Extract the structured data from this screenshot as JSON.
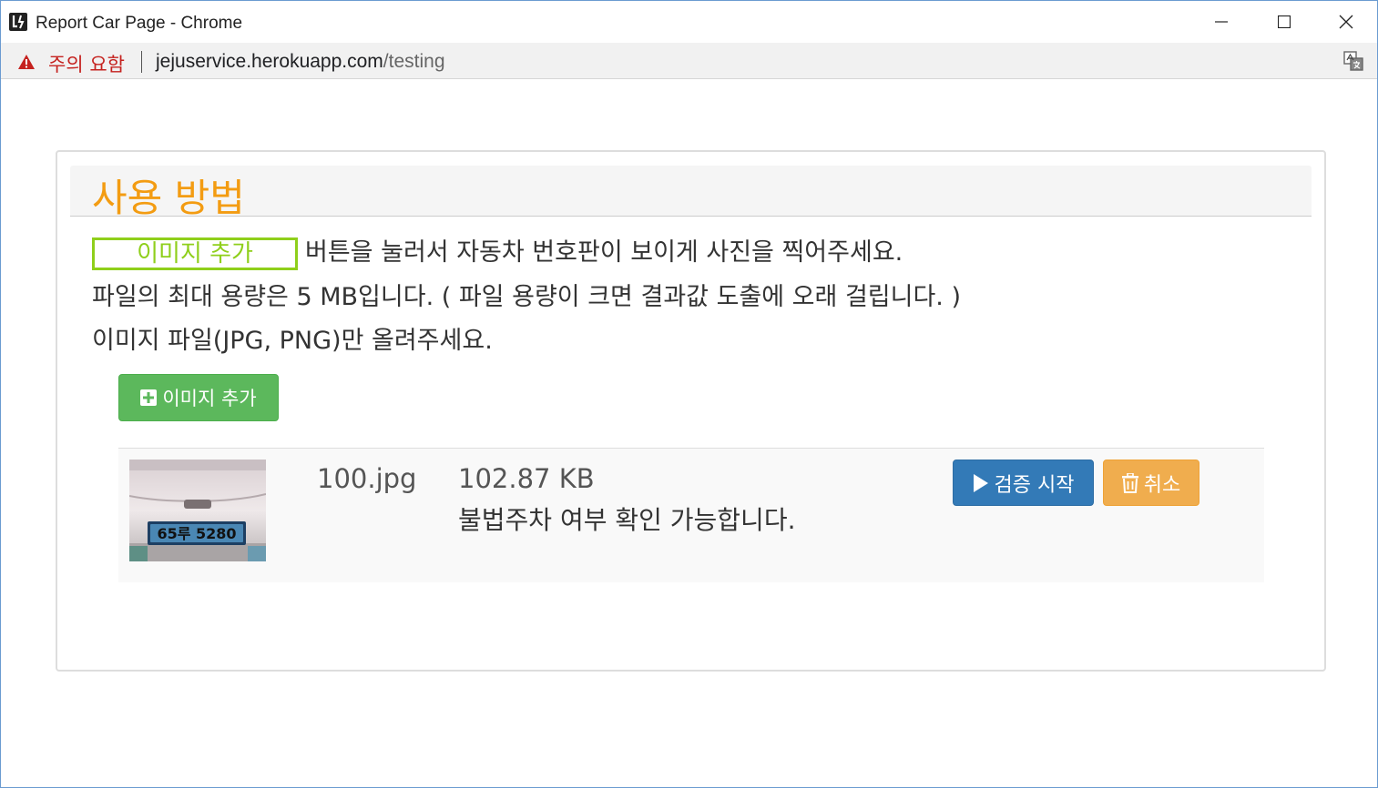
{
  "window": {
    "title": "Report Car Page - Chrome"
  },
  "addressbar": {
    "security_warning": "주의 요함",
    "url_host": "jejuservice.herokuapp.com",
    "url_path": "/testing"
  },
  "panel": {
    "title": "사용 방법",
    "inline_button_label": "이미지 추가",
    "line1_text": "버튼을 눌러서 자동차 번호판이 보이게 사진을 찍어주세요.",
    "line2_text": "파일의 최대 용량은 5 MB입니다. ( 파일 용량이 크면 결과값 도출에 오래 걸립니다. )",
    "line3_text": "이미지 파일(JPG, PNG)만 올려주세요."
  },
  "add_button": {
    "label": "이미지 추가",
    "icon": "plus-square-icon"
  },
  "file": {
    "name": "100.jpg",
    "size": "102.87 KB",
    "status": "불법주차 여부 확인 가능합니다.",
    "plate_text": "65루 5280",
    "verify_label": "검증 시작",
    "verify_icon": "play-icon",
    "cancel_label": "취소",
    "cancel_icon": "trash-icon"
  },
  "colors": {
    "heading": "#f39c12",
    "outline_button": "#8fcf1b",
    "success": "#5cb85c",
    "primary": "#337ab7",
    "warning": "#f0ad4e",
    "warning_text": "#c5221f"
  }
}
